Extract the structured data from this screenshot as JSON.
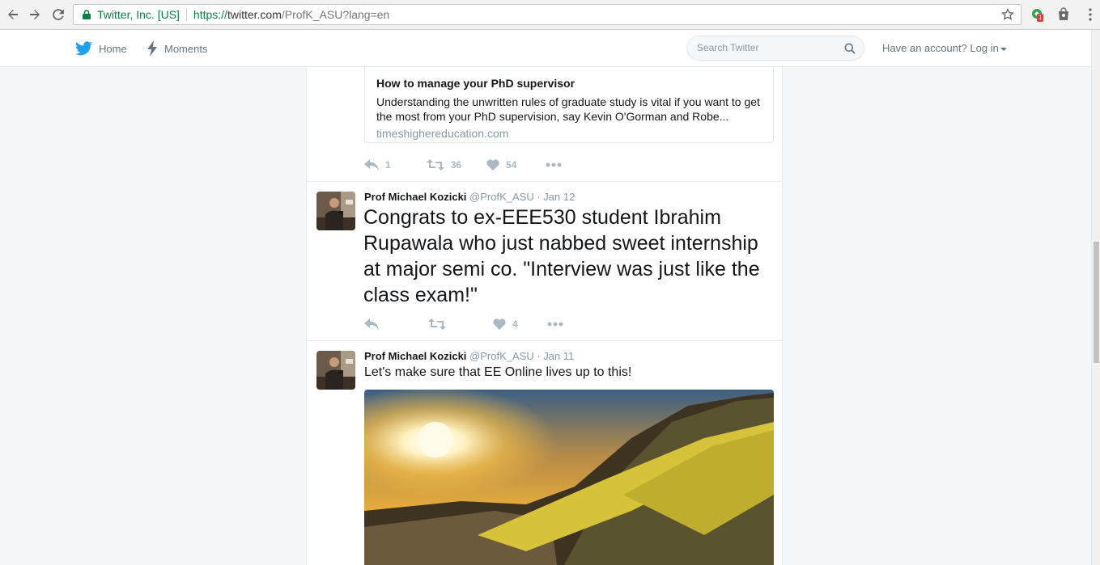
{
  "browser": {
    "org_label": "Twitter, Inc. [US]",
    "url_scheme": "https://",
    "url_host": "twitter.com",
    "url_path": "/ProfK_ASU?lang=en",
    "extension_badge": "1"
  },
  "topbar": {
    "home_label": "Home",
    "moments_label": "Moments",
    "search_placeholder": "Search Twitter",
    "login_label": "Have an account? Log in"
  },
  "tweets": [
    {
      "card": {
        "title": "How to manage your PhD supervisor",
        "description": "Understanding the unwritten rules of graduate study is vital if you want to get the most from your PhD supervision, say Kevin O'Gorman and Robe...",
        "domain": "timeshighereducation.com"
      },
      "reply_count": "1",
      "retweet_count": "36",
      "like_count": "54"
    },
    {
      "fullname": "Prof Michael Kozicki",
      "handle": "@ProfK_ASU",
      "time": "· Jan 12",
      "text": "Congrats to ex-EEE530 student Ibrahim Rupawala who just nabbed sweet internship at major semi co. \"Interview was just like the class exam!\"",
      "reply_count": "",
      "retweet_count": "",
      "like_count": "4"
    },
    {
      "fullname": "Prof Michael Kozicki",
      "handle": "@ProfK_ASU",
      "time": "· Jan 11",
      "text": "Let's make sure that EE Online lives up to this!"
    }
  ],
  "colors": {
    "twitter_blue": "#1da1f2",
    "secure_green": "#0b8043",
    "muted_text": "#8899a6",
    "action_gray": "#aab8c2"
  }
}
